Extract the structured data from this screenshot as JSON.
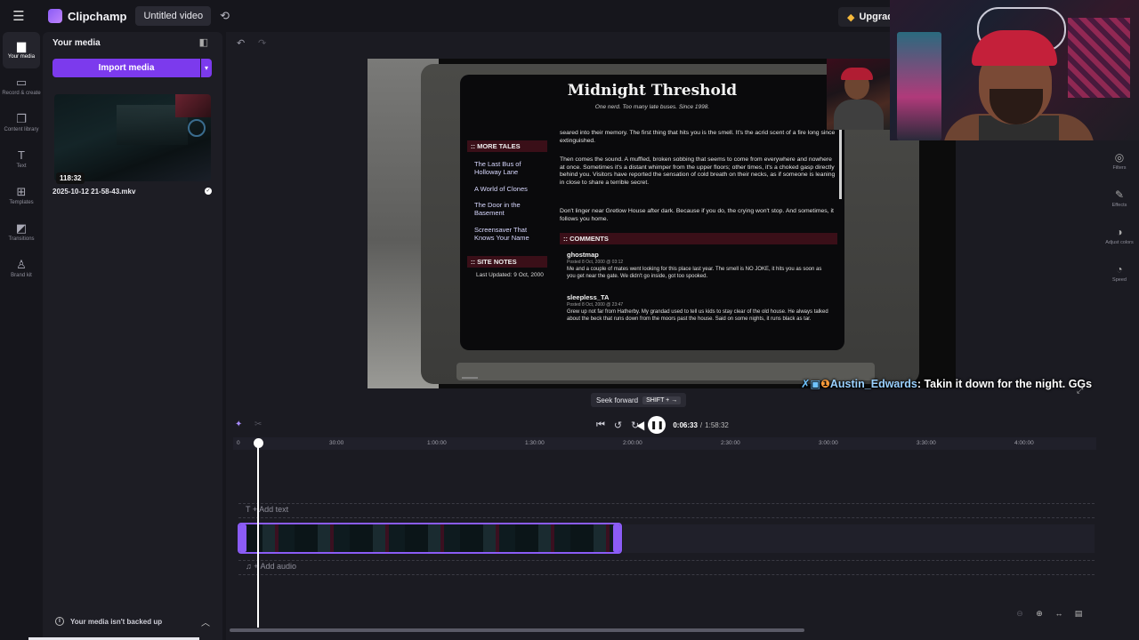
{
  "topbar": {
    "brand": "Clipchamp",
    "video_title": "Untitled video",
    "upgrade_label": "Upgrad"
  },
  "rail": {
    "items": [
      {
        "label": "Your media",
        "icon": "folder-icon"
      },
      {
        "label": "Record & create",
        "icon": "camera-icon"
      },
      {
        "label": "Content library",
        "icon": "library-icon"
      },
      {
        "label": "Text",
        "icon": "text-icon"
      },
      {
        "label": "Templates",
        "icon": "templates-icon"
      },
      {
        "label": "Transitions",
        "icon": "transitions-icon"
      },
      {
        "label": "Brand kit",
        "icon": "brand-kit-icon"
      }
    ]
  },
  "media": {
    "title": "Your media",
    "import_label": "Import media",
    "file": {
      "duration": "118:32",
      "name": "2025-10-12 21-58-43.mkv"
    },
    "backup_warning": "Your media isn't backed up"
  },
  "preview": {
    "site_title": "Midnight Threshold",
    "site_tagline": "One nerd. Too many late buses. Since 1998.",
    "more_tales_head": ":: MORE TALES",
    "tales": [
      "The Last Bus of Holloway Lane",
      "A World of Clones",
      "The Door in the Basement",
      "Screensaver That Knows Your Name"
    ],
    "site_notes_head": ":: SITE NOTES",
    "last_updated": "Last Updated: 9 Oct, 2000",
    "body_1": "seared into their memory. The first thing that hits you is the smell. It's the acrid scent of a fire long since extinguished.",
    "body_2": "Then comes the sound. A muffled, broken sobbing that seems to come from everywhere and nowhere at once. Sometimes it's a distant whimper from the upper floors; other times, it's a choked gasp directly behind you. Visitors have reported the sensation of cold breath on their necks, as if someone is leaning in close to share a terrible secret.",
    "body_3": "Don't linger near Gretlow House after dark. Because if you do, the crying won't stop. And sometimes, it follows you home.",
    "comments_head": ":: COMMENTS",
    "comments": [
      {
        "name": "ghostmap",
        "date": "Posted 8 Oct, 2000 @ 03:12",
        "text": "Me and a couple of mates went looking for this place last year. The smell is NO JOKE, it hits you as soon as you get near the gate. We didn't go inside, got too spooked."
      },
      {
        "name": "sleepless_TA",
        "date": "Posted 8 Oct, 2000 @ 23:47",
        "text": "Grew up not far from Hatherby. My grandad used to tell us kids to stay clear of the old house. He always talked about the beck that runs down from the moors past the house. Said on some nights, it runs black as tar."
      }
    ]
  },
  "chat": {
    "username": "Austin_Edwards",
    "message": ": Takin it down for the night. GGs"
  },
  "tools": [
    {
      "label": "Filters",
      "icon": "filters-icon"
    },
    {
      "label": "Effects",
      "icon": "effects-icon"
    },
    {
      "label": "Adjust colors",
      "icon": "adjust-colors-icon"
    },
    {
      "label": "Speed",
      "icon": "speed-icon"
    }
  ],
  "tooltip": {
    "label": "Seek forward",
    "shortcut": "SHIFT + →"
  },
  "transport": {
    "current": "0:06:33",
    "separator": "/",
    "total": "1:58:32"
  },
  "ruler": {
    "ticks": [
      "0",
      "30:00",
      "1:00:00",
      "1:30:00",
      "2:00:00",
      "2:30:00",
      "3:00:00",
      "3:30:00",
      "4:00:00"
    ]
  },
  "timeline": {
    "add_text": "Add text",
    "add_audio": "Add audio"
  },
  "colors": {
    "accent": "#7c3aed",
    "clip_border": "#8b5cf6",
    "background": "#16161c"
  }
}
